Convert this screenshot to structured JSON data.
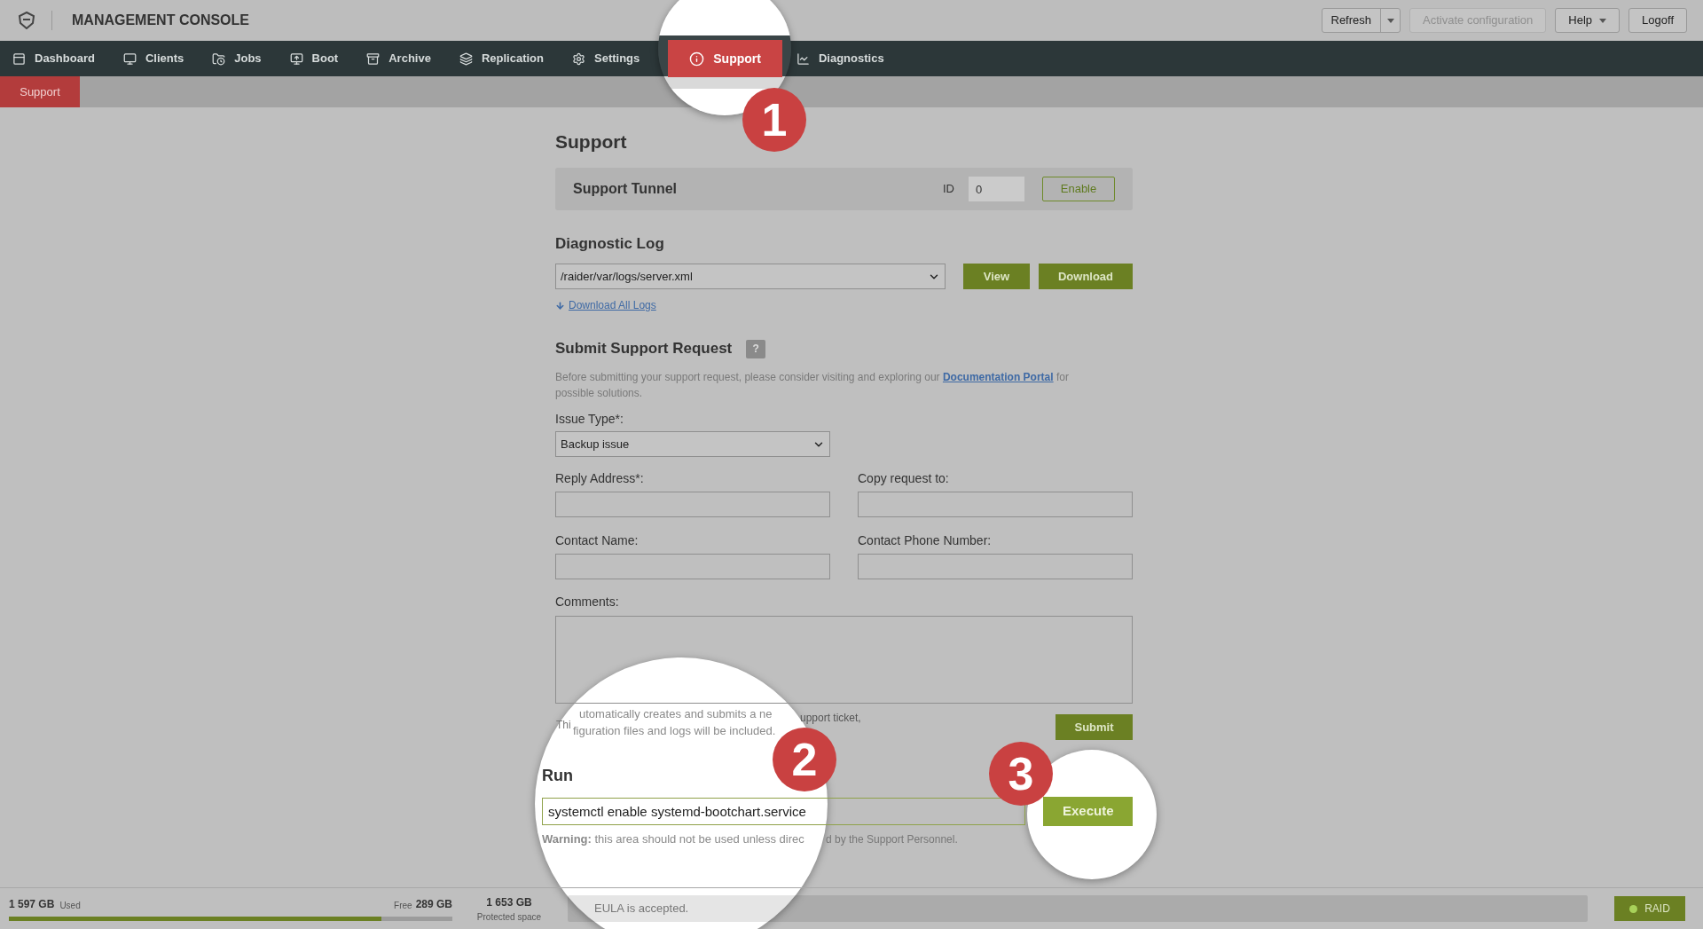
{
  "header": {
    "title": "MANAGEMENT CONSOLE",
    "buttons": [
      {
        "label": "Refresh",
        "kind": "split",
        "disabled": false
      },
      {
        "label": "Activate configuration",
        "kind": "plain",
        "disabled": true
      },
      {
        "label": "Help",
        "kind": "dropdown",
        "disabled": false
      },
      {
        "label": "Logoff",
        "kind": "plain",
        "disabled": false
      }
    ]
  },
  "nav": [
    {
      "label": "Dashboard",
      "selected": false
    },
    {
      "label": "Clients",
      "selected": false
    },
    {
      "label": "Jobs",
      "selected": false
    },
    {
      "label": "Boot",
      "selected": false
    },
    {
      "label": "Archive",
      "selected": false
    },
    {
      "label": "Replication",
      "selected": false
    },
    {
      "label": "Settings",
      "selected": false
    },
    {
      "label": "Support",
      "selected": true
    },
    {
      "label": "Diagnostics",
      "selected": false
    }
  ],
  "breadcrumb": "Support",
  "page_title": "Support",
  "support_tunnel": {
    "title": "Support Tunnel",
    "id_label": "ID",
    "id_value": "0",
    "button": "Enable"
  },
  "diagnostic_log": {
    "title": "Diagnostic Log",
    "file": "/raider/var/logs/server.xml",
    "buttons": [
      "View",
      "Download"
    ],
    "download_all": "Download All Logs"
  },
  "support_request": {
    "title": "Submit Support Request",
    "help": "?",
    "intro_before": "Before submitting your support request, please consider visiting and exploring our",
    "intro_link": "Documentation Portal",
    "intro_after": "for possible solutions.",
    "issue_type": {
      "label": "Issue Type*:",
      "value": "Backup issue"
    },
    "fields": [
      {
        "label": "Reply Address*:"
      },
      {
        "label": "Copy request to:"
      },
      {
        "label": "Contact Name:"
      },
      {
        "label": "Contact Phone Number:"
      }
    ],
    "comments_label": "Comments:",
    "note": {
      "start": "Thi",
      "magnified_1": "utomatically creates and submits a ne",
      "end": "upport ticket,",
      "magnified_2": "figuration files and logs will be included."
    },
    "submit": "Submit"
  },
  "run": {
    "title": "Run",
    "value": "systemctl enable systemd-bootchart.service",
    "button": "Execute",
    "warning_bold": "Warning:",
    "warning_magnified": "this area should not be used unless direc",
    "warning_end": "d by the Support Personnel."
  },
  "footer": {
    "used": "1 597 GB",
    "used_label": "Used",
    "free_label": "Free",
    "free": "289 GB",
    "level": 0.84,
    "protected": "1 653 GB",
    "protected_label": "Protected space",
    "eula": "EULA is accepted.",
    "raid": "RAID"
  },
  "markers": [
    "1",
    "2",
    "3"
  ]
}
